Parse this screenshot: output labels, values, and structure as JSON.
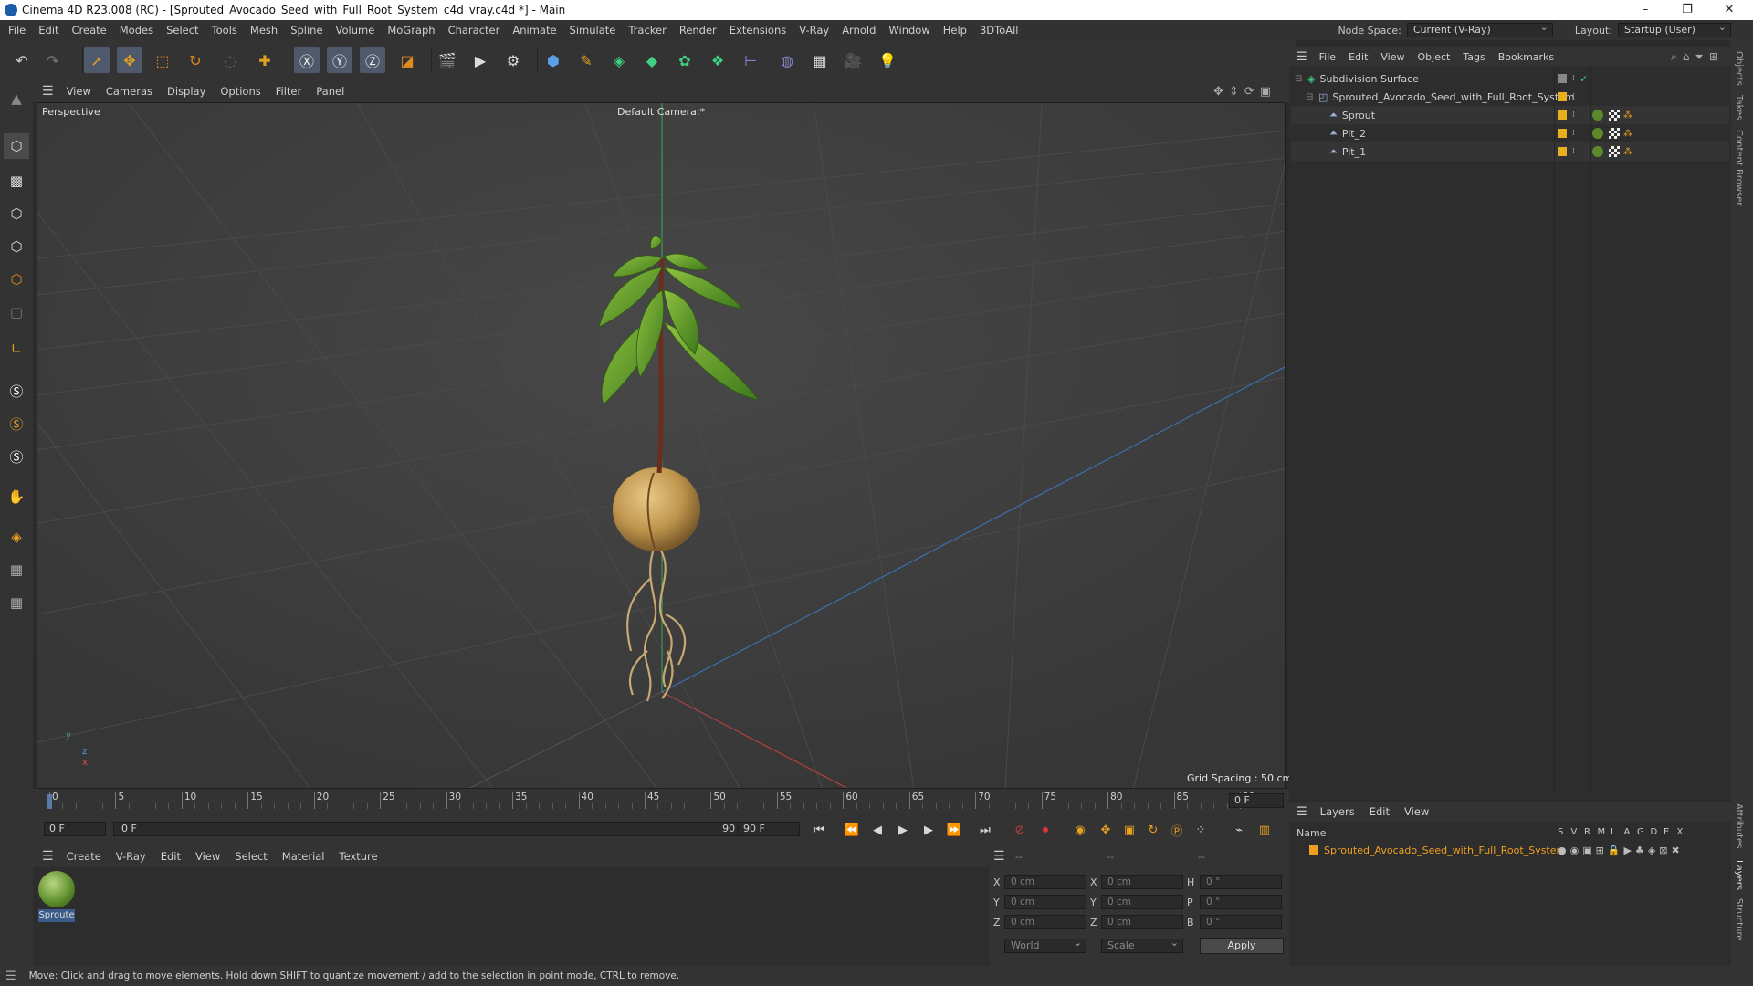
{
  "window": {
    "title": "Cinema 4D R23.008 (RC) - [Sprouted_Avocado_Seed_with_Full_Root_System_c4d_vray.c4d *] - Main",
    "minimize": "–",
    "maximize": "❐",
    "close": "✕"
  },
  "menubar": {
    "items": [
      "File",
      "Edit",
      "Create",
      "Modes",
      "Select",
      "Tools",
      "Mesh",
      "Spline",
      "Volume",
      "MoGraph",
      "Character",
      "Animate",
      "Simulate",
      "Tracker",
      "Render",
      "Extensions",
      "V-Ray",
      "Arnold",
      "Window",
      "Help",
      "3DToAll"
    ],
    "node_space_label": "Node Space:",
    "node_space_value": "Current (V-Ray)",
    "layout_label": "Layout:",
    "layout_value": "Startup (User)"
  },
  "viewport": {
    "menu": [
      "View",
      "Cameras",
      "Display",
      "Options",
      "Filter",
      "Panel"
    ],
    "label": "Perspective",
    "camera": "Default Camera:*",
    "grid_spacing": "Grid Spacing : 50 cm",
    "axis_y": "y",
    "axis_z": "z",
    "axis_x": "x"
  },
  "timeline": {
    "ticks": [
      "0",
      "5",
      "10",
      "15",
      "20",
      "25",
      "30",
      "35",
      "40",
      "45",
      "50",
      "55",
      "60",
      "65",
      "70",
      "75",
      "80",
      "85",
      "90"
    ],
    "current_frame": "0 F",
    "start_frame": "0 F",
    "range_start": "0 F",
    "range_end": "90 F",
    "end_frame": "90 F"
  },
  "material_panel": {
    "menu": [
      "Create",
      "V-Ray",
      "Edit",
      "View",
      "Select",
      "Material",
      "Texture"
    ],
    "material_name": "Sproute"
  },
  "coordinates": {
    "header_dashes": [
      "--",
      "--",
      "--"
    ],
    "rows": [
      {
        "axis": "X",
        "pos": "0 cm",
        "axis2": "X",
        "size": "0 cm",
        "rot_axis": "H",
        "rot": "0 °"
      },
      {
        "axis": "Y",
        "pos": "0 cm",
        "axis2": "Y",
        "size": "0 cm",
        "rot_axis": "P",
        "rot": "0 °"
      },
      {
        "axis": "Z",
        "pos": "0 cm",
        "axis2": "Z",
        "size": "0 cm",
        "rot_axis": "B",
        "rot": "0 °"
      }
    ],
    "space": "World",
    "mode": "Scale",
    "apply": "Apply"
  },
  "objects_panel": {
    "menu": [
      "File",
      "Edit",
      "View",
      "Object",
      "Tags",
      "Bookmarks"
    ],
    "items": [
      {
        "name": "Subdivision Surface",
        "indent": 0
      },
      {
        "name": "Sprouted_Avocado_Seed_with_Full_Root_System",
        "indent": 1
      },
      {
        "name": "Sprout",
        "indent": 2
      },
      {
        "name": "Pit_2",
        "indent": 2
      },
      {
        "name": "Pit_1",
        "indent": 2
      }
    ]
  },
  "layers_panel": {
    "menu": [
      "Layers",
      "Edit",
      "View"
    ],
    "col_name": "Name",
    "flags": [
      "S",
      "V",
      "R",
      "M",
      "L",
      "A",
      "G",
      "D",
      "E",
      "X"
    ],
    "layer_name": "Sprouted_Avocado_Seed_with_Full_Root_System",
    "layer_color": "#f0a020"
  },
  "right_tabs": [
    "Objects",
    "Takes",
    "Content Browser",
    "Attributes",
    "Layers",
    "Structure"
  ],
  "status": "Move: Click and drag to move elements. Hold down SHIFT to quantize movement / add to the selection in point mode, CTRL to remove.",
  "colors": {
    "accent": "#4e6a8f",
    "orange": "#e8a020",
    "viewport_bg": "#3d3d3d"
  }
}
